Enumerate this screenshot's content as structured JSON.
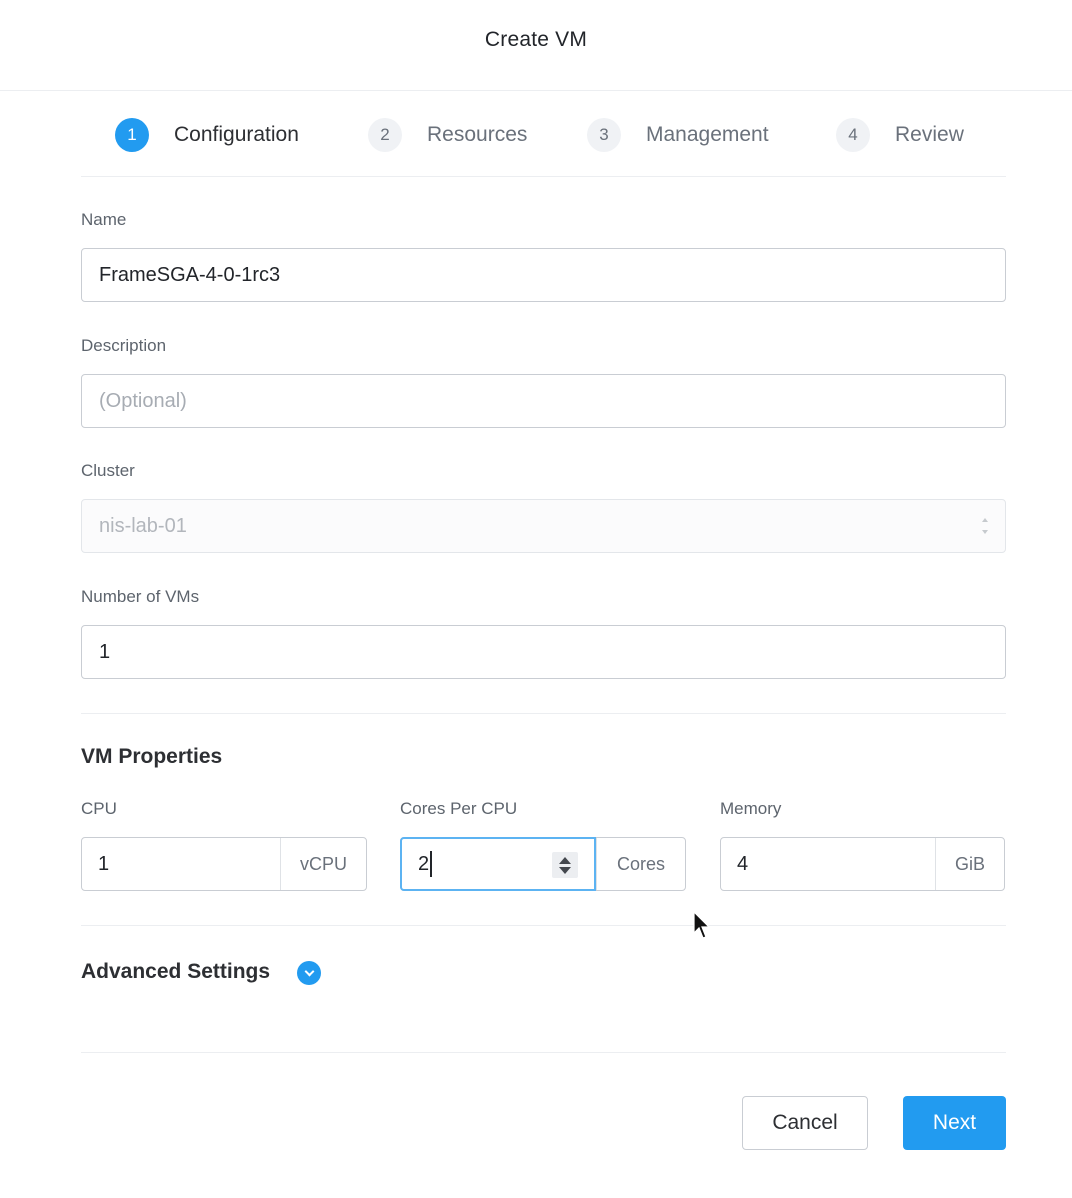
{
  "dialog": {
    "title": "Create VM"
  },
  "steps": [
    {
      "number": "1",
      "label": "Configuration",
      "active": true
    },
    {
      "number": "2",
      "label": "Resources",
      "active": false
    },
    {
      "number": "3",
      "label": "Management",
      "active": false
    },
    {
      "number": "4",
      "label": "Review",
      "active": false
    }
  ],
  "form": {
    "name": {
      "label": "Name",
      "value": "FrameSGA-4-0-1rc3"
    },
    "description": {
      "label": "Description",
      "placeholder": "(Optional)",
      "value": ""
    },
    "cluster": {
      "label": "Cluster",
      "value": "nis-lab-01",
      "disabled": true
    },
    "num_vms": {
      "label": "Number of VMs",
      "value": "1"
    }
  },
  "vm_properties": {
    "title": "VM Properties",
    "cpu": {
      "label": "CPU",
      "value": "1",
      "unit": "vCPU"
    },
    "cores_per_cpu": {
      "label": "Cores Per CPU",
      "value": "2",
      "unit": "Cores",
      "focused": true
    },
    "memory": {
      "label": "Memory",
      "value": "4",
      "unit": "GiB"
    }
  },
  "advanced": {
    "title": "Advanced Settings",
    "icon": "chevron-down-circle-icon"
  },
  "footer": {
    "cancel_label": "Cancel",
    "next_label": "Next"
  },
  "colors": {
    "accent": "#229bf0",
    "text": "#2d2f33",
    "muted": "#6a717b",
    "border": "#c9cdd3"
  }
}
